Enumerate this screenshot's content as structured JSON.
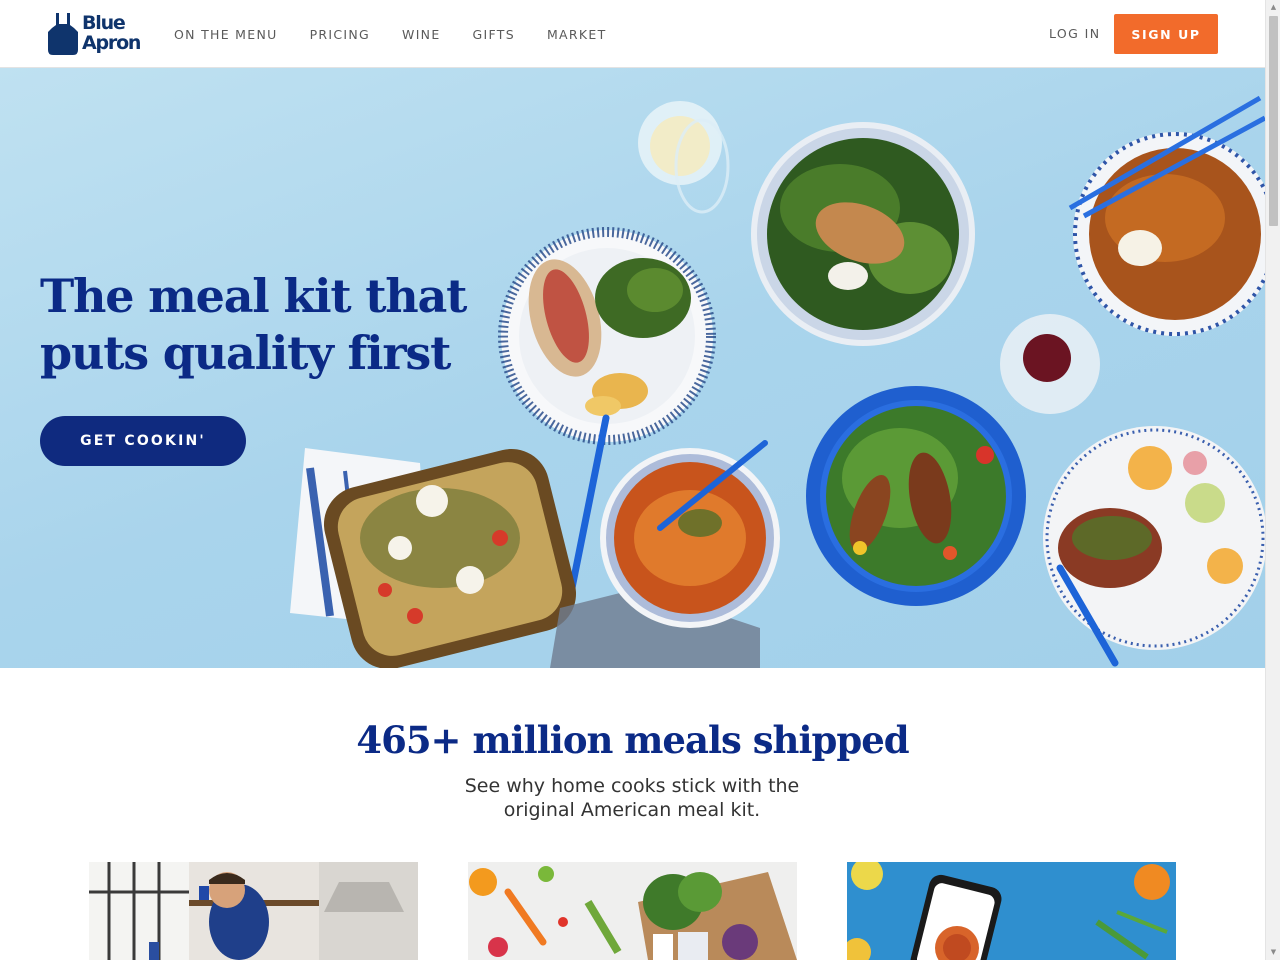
{
  "brand": {
    "line1": "Blue",
    "line2": "Apron",
    "color": "#0f346c"
  },
  "nav": {
    "items": [
      {
        "label": "ON THE MENU"
      },
      {
        "label": "PRICING"
      },
      {
        "label": "WINE"
      },
      {
        "label": "GIFTS"
      },
      {
        "label": "MARKET"
      }
    ],
    "login_label": "LOG IN",
    "signup_label": "SIGN UP",
    "signup_color": "#f26b2b"
  },
  "hero": {
    "title": "The meal kit that puts quality first",
    "cta_label": "GET COOKIN'",
    "title_color": "#0b2a86",
    "background_color": "#aad4ec"
  },
  "stats": {
    "title": "465+ million meals shipped",
    "subtitle": "See why home cooks stick with the original American meal kit."
  },
  "cards": [
    {
      "icon": "chef-cooking-photo"
    },
    {
      "icon": "fresh-ingredients-photo"
    },
    {
      "icon": "phone-app-photo"
    }
  ]
}
